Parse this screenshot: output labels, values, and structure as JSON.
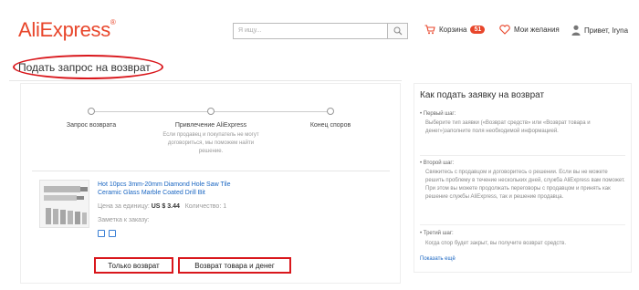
{
  "header": {
    "logo": "AliExpress",
    "search_placeholder": "Я ищу...",
    "cart_label": "Корзина",
    "cart_count": "51",
    "wishlist_label": "Мои желания",
    "greeting": "Привет, Iryna"
  },
  "page": {
    "title": "Подать запрос на возврат"
  },
  "steps": [
    {
      "label": "Запрос возврата",
      "desc": ""
    },
    {
      "label": "Привлечение AliExpress",
      "desc": "Если продавец и покупатель не могут договориться, мы поможем найти решение."
    },
    {
      "label": "Конец споров",
      "desc": ""
    }
  ],
  "product": {
    "title": "Hot 10pcs 3mm-20mm Diamond Hole Saw Tile Ceramic Glass Marble Coated Drill Bit",
    "price_label": "Цена за единицу:",
    "price_value": "US $ 3.44",
    "qty_label": "Количество: 1",
    "note": "Заметка к заказу:"
  },
  "buttons": {
    "refund_only": "Только возврат",
    "return_and_refund": "Возврат товара и денег"
  },
  "help": {
    "title": "Как подать заявку на возврат",
    "step1_label": "• Первый шаг:",
    "step1_text": "Выберите тип заявки («Возврат средств» или «Возврат товара и денег»)заполните поля необходимой информацией.",
    "step2_label": "• Второй шаг:",
    "step2_text": "Свяжитесь с продавцом и договоритесь о решении. Если вы не можете решить проблему в течение нескольких дней, служба AliExpress вам поможет. При этом вы можете продолжать переговоры с продавцом и принять как решение службы AliExpress, так и решение продавца.",
    "step3_label": "• Третий шаг:",
    "step3_text": "Когда спор будет закрыт, вы получите возврат средств.",
    "more_link": "Показать ещё"
  }
}
